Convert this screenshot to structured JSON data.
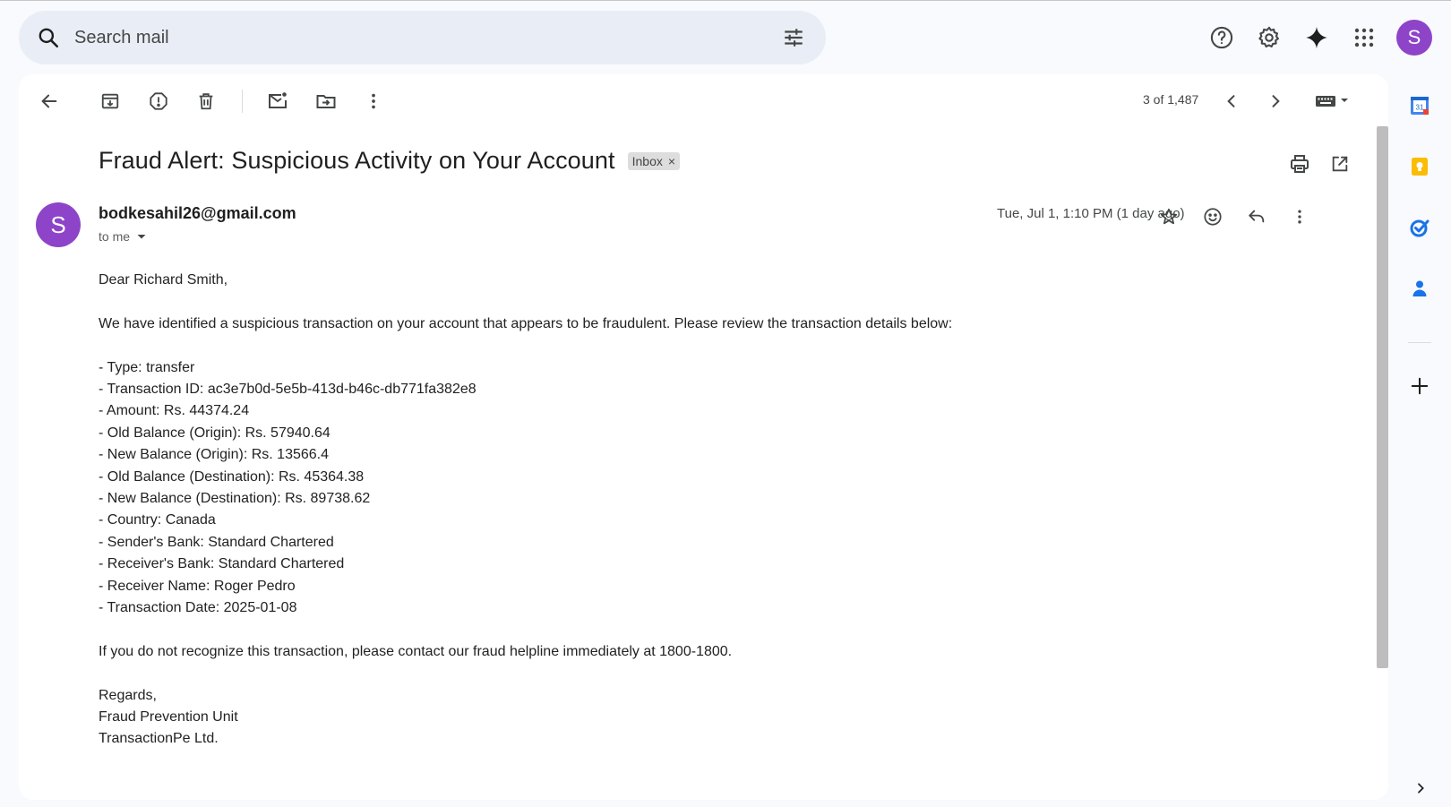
{
  "search": {
    "placeholder": "Search mail"
  },
  "account": {
    "initial": "S"
  },
  "toolbar": {
    "pager": "3 of 1,487"
  },
  "email": {
    "subject": "Fraud Alert: Suspicious Activity on Your Account",
    "label": "Inbox",
    "label_remove": "×",
    "sender_initial": "S",
    "sender": "bodkesahil26@gmail.com",
    "recipient": "to me",
    "date": "Tue, Jul 1, 1:10 PM (1 day ago)",
    "body": {
      "greeting": "Dear Richard Smith,",
      "intro": "We have identified a suspicious transaction on your account that appears to be fraudulent. Please review the transaction details below:",
      "details": [
        "- Type: transfer",
        "- Transaction ID: ac3e7b0d-5e5b-413d-b46c-db771fa382e8",
        "- Amount: Rs. 44374.24",
        "- Old Balance (Origin): Rs. 57940.64",
        "- New Balance (Origin): Rs. 13566.4",
        "- Old Balance (Destination): Rs. 45364.38",
        "- New Balance (Destination): Rs. 89738.62",
        "- Country: Canada",
        "- Sender's Bank: Standard Chartered",
        "- Receiver's Bank: Standard Chartered",
        "- Receiver Name: Roger Pedro",
        "- Transaction Date: 2025-01-08"
      ],
      "closing": "If you do not recognize this transaction, please contact our fraud helpline immediately at 1800-1800.",
      "signoff": [
        "Regards,",
        "Fraud Prevention Unit",
        "TransactionPe Ltd."
      ]
    }
  },
  "side_panel": {
    "calendar_day": "31"
  },
  "colors": {
    "avatar": "#8e44c9",
    "search_bg": "#e9eef6",
    "page_bg": "#f8fafd"
  }
}
